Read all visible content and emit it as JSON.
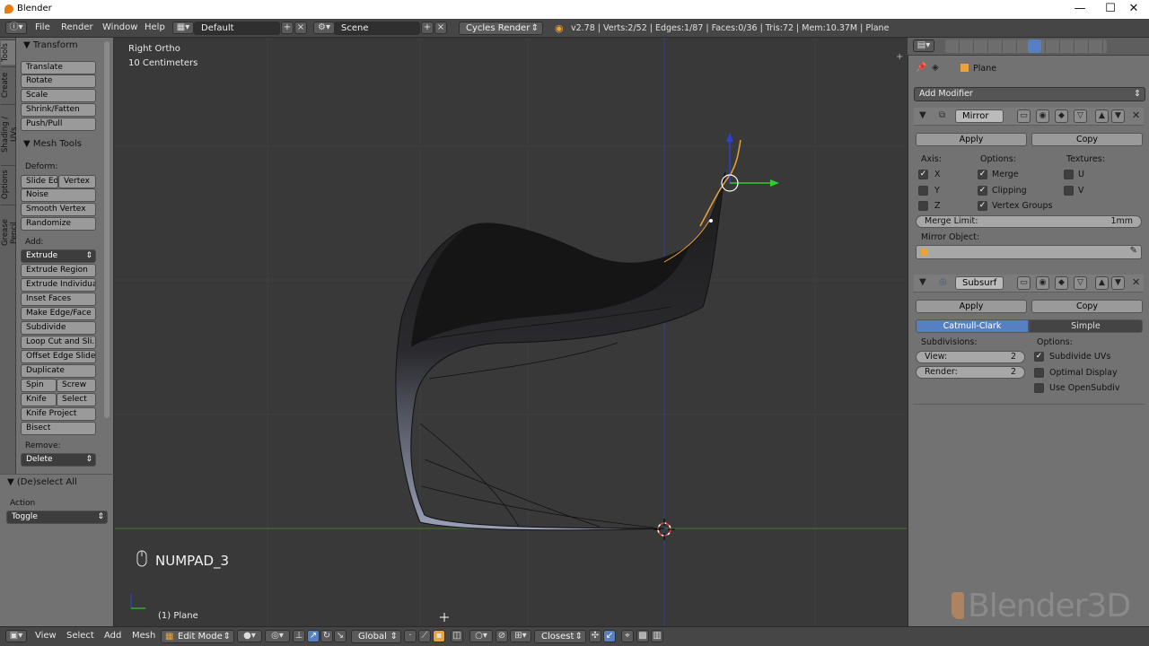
{
  "window": {
    "title": "Blender",
    "minimize": "—",
    "maximize": "☐",
    "close": "✕"
  },
  "infobar": {
    "menus": [
      "File",
      "Render",
      "Window",
      "Help"
    ],
    "layout": "Default",
    "scene": "Scene",
    "engine": "Cycles Render",
    "stats": "v2.78 | Verts:2/52 | Edges:1/87 | Faces:0/36 | Tris:72 | Mem:10.37M | Plane"
  },
  "toolshelf": {
    "tabs": [
      "Tools",
      "Create",
      "Shading / UVs",
      "Options",
      "Grease Pencil"
    ],
    "transform": {
      "title": "Transform",
      "buttons": [
        "Translate",
        "Rotate",
        "Scale",
        "Shrink/Fatten",
        "Push/Pull"
      ]
    },
    "meshtools": {
      "title": "Mesh Tools",
      "deform_label": "Deform:",
      "slide_edge": "Slide Ed",
      "vertex": "Vertex",
      "noise": "Noise",
      "smooth_vertex": "Smooth Vertex",
      "randomize": "Randomize",
      "add_label": "Add:",
      "extrude": "Extrude",
      "add_buttons": [
        "Extrude Region",
        "Extrude Individual",
        "Inset Faces",
        "Make Edge/Face",
        "Subdivide",
        "Loop Cut and Sli...",
        "Offset Edge Slide",
        "Duplicate"
      ],
      "spin": "Spin",
      "screw": "Screw",
      "knife": "Knife",
      "select": "Select",
      "knife_project": "Knife Project",
      "bisect": "Bisect",
      "remove_label": "Remove:",
      "delete": "Delete"
    }
  },
  "operator": {
    "title": "(De)select All",
    "action_label": "Action",
    "action_value": "Toggle"
  },
  "viewport": {
    "view_name": "Right Ortho",
    "scale": "10 Centimeters",
    "key": "NUMPAD_3",
    "object": "(1) Plane"
  },
  "statusbar": {
    "menus": [
      "View",
      "Select",
      "Add",
      "Mesh"
    ],
    "mode": "Edit Mode",
    "orientation": "Global",
    "snap": "Closest"
  },
  "properties": {
    "object": "Plane",
    "add_modifier": "Add Modifier",
    "mirror": {
      "name": "Mirror",
      "apply": "Apply",
      "copy": "Copy",
      "axis_label": "Axis:",
      "options_label": "Options:",
      "textures_label": "Textures:",
      "x": "X",
      "y": "Y",
      "z": "Z",
      "merge": "Merge",
      "clipping": "Clipping",
      "vertex_groups": "Vertex Groups",
      "u": "U",
      "v": "V",
      "merge_limit_label": "Merge Limit:",
      "merge_limit_value": "1mm",
      "mirror_object_label": "Mirror Object:"
    },
    "subsurf": {
      "name": "Subsurf",
      "apply": "Apply",
      "copy": "Copy",
      "catmull": "Catmull-Clark",
      "simple": "Simple",
      "subdivisions_label": "Subdivisions:",
      "options_label": "Options:",
      "view_label": "View:",
      "view_value": "2",
      "render_label": "Render:",
      "render_value": "2",
      "subdivide_uvs": "Subdivide UVs",
      "optimal_display": "Optimal Display",
      "use_opensubdiv": "Use OpenSubdiv"
    }
  },
  "watermark": "Blender3D",
  "colors": {
    "accent": "#5680c2",
    "object_orange": "#e8a33a",
    "x_axis": "#7c2f2f",
    "y_axis": "#3f7a2f",
    "z_axis": "#2f3f9a"
  }
}
